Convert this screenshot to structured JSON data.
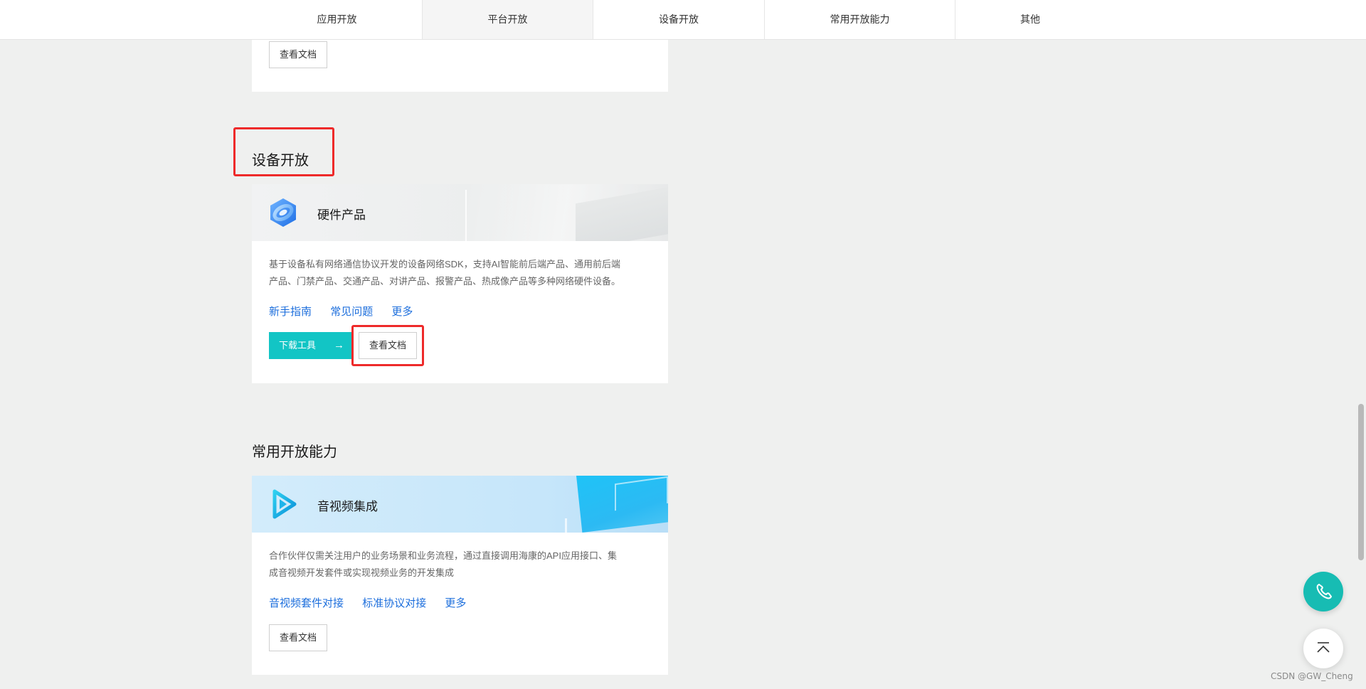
{
  "nav": {
    "tabs": [
      {
        "label": "应用开放"
      },
      {
        "label": "平台开放"
      },
      {
        "label": "设备开放"
      },
      {
        "label": "常用开放能力"
      },
      {
        "label": "其他"
      }
    ],
    "active_tab": "平台开放"
  },
  "prev_card": {
    "doc_button": "查看文档"
  },
  "device_section": {
    "title": "设备开放",
    "card": {
      "title": "硬件产品",
      "icon": "hardware-product-icon",
      "description": [
        "基于设备私有网络通信协议开发的设备网络SDK，支持AI智能前后端产品、通用前后端",
        "产品、门禁产品、交通产品、对讲产品、报警产品、热成像产品等多种网络硬件设备。"
      ],
      "links": [
        "新手指南",
        "常见问题",
        "更多"
      ],
      "download_button": "下载工具",
      "doc_button": "查看文档"
    }
  },
  "capability_section": {
    "title": "常用开放能力",
    "card": {
      "title": "音视频集成",
      "icon": "video-play-icon",
      "description": [
        "合作伙伴仅需关注用户的业务场景和业务流程，通过直接调用海康的API应用接口、集",
        "成音视频开发套件或实现视频业务的开发集成"
      ],
      "links": [
        "音视频套件对接",
        "标准协议对接",
        "更多"
      ],
      "doc_button": "查看文档"
    }
  },
  "floating": {
    "phone_icon": "phone-icon",
    "top_icon": "back-to-top-icon"
  },
  "watermark": "CSDN @GW_Cheng",
  "colors": {
    "primary": "#12c5c5",
    "link": "#1c6edc",
    "highlight": "#ee2a2a",
    "fab": "#17bcb3"
  }
}
